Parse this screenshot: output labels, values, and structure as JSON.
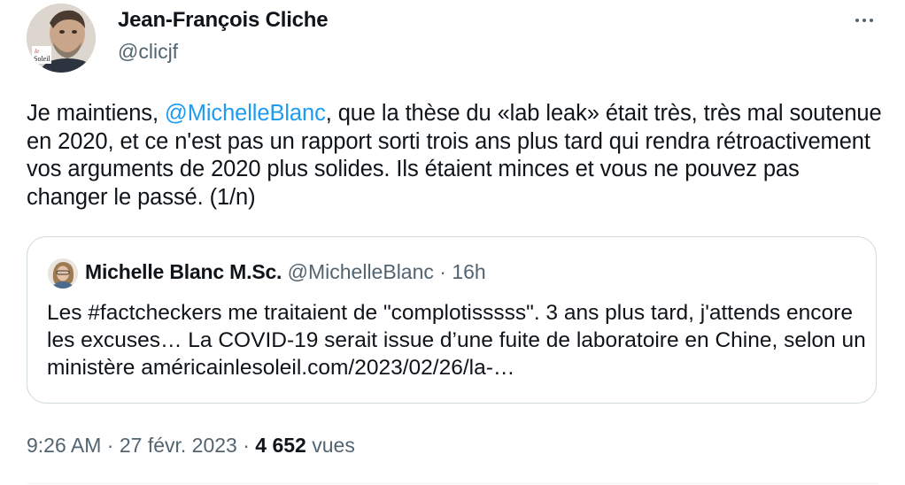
{
  "author": {
    "name": "Jean-François Cliche",
    "handle": "@clicjf",
    "avatar_badge": "le Soleil"
  },
  "more_icon": "more-horizontal-icon",
  "tweet": {
    "text_before_mention": "Je maintiens, ",
    "mention": "@MichelleBlanc",
    "text_after_mention": ", que la thèse du «lab leak» était très, très mal soutenue en 2020, et ce n'est pas un rapport sorti trois ans plus tard qui rendra rétroactivement vos arguments de 2020 plus solides. Ils étaient minces et vous ne pouvez pas changer le passé. (1/n)"
  },
  "quoted_tweet": {
    "name": "Michelle Blanc M.Sc.",
    "handle": "@MichelleBlanc",
    "separator": "·",
    "age": "16h",
    "text": "Les #factcheckers me traitaient de \"complotisssss\". 3 ans plus tard, j'attends encore les excuses…  La COVID-19 serait issue d’une fuite de laboratoire en Chine, selon un ministère américainlesoleil.com/2023/02/26/la-…"
  },
  "footer": {
    "time": "9:26 AM",
    "separator1": "·",
    "date": "27 févr. 2023",
    "separator2": "·",
    "views_count": "4 652",
    "views_label": "vues"
  },
  "colors": {
    "link": "#1d9bf0",
    "text": "#0f1419",
    "secondary": "#536471",
    "border": "#cfd9de"
  }
}
